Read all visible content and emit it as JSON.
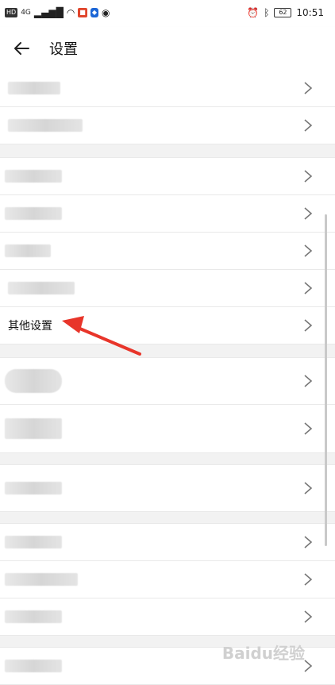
{
  "status": {
    "left": [
      "HD",
      "4G",
      "LTE"
    ],
    "time": "10:51",
    "battery": "62"
  },
  "header": {
    "title": "设置"
  },
  "rows": {
    "r1": "",
    "r2": "",
    "r3": "",
    "r4": "",
    "r5": "",
    "r6": "",
    "r7": "其他设置",
    "r8": "",
    "r9": "",
    "r10": "",
    "r11": "",
    "r12": "",
    "r13": "",
    "r14": ""
  },
  "colors": {
    "arrow": "#e8352a",
    "separator": "#f2f2f2"
  },
  "watermark": "Baidu经验"
}
